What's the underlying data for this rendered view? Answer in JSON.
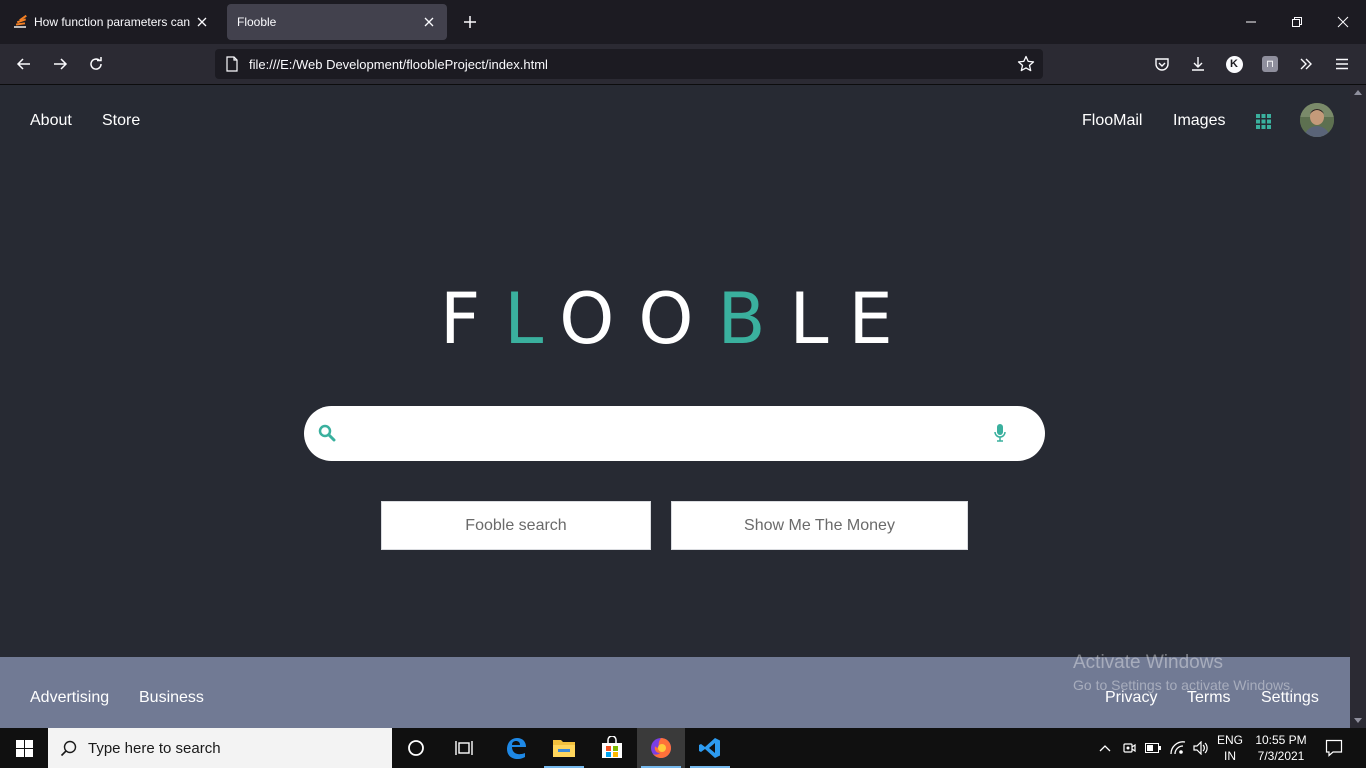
{
  "browser": {
    "tabs": [
      {
        "title": "How function parameters can in",
        "active": false
      },
      {
        "title": "Flooble",
        "active": true
      }
    ],
    "url": "file:///E:/Web Development/floobleProject/index.html",
    "toolbar_avatar_letter": "K"
  },
  "page": {
    "nav_left": [
      "About",
      "Store"
    ],
    "nav_right": [
      "FlooMail",
      "Images"
    ],
    "logo_letters": [
      "F",
      "L",
      "O",
      "O",
      "B",
      "L",
      "E"
    ],
    "logo_accent_color": "#3ab09e",
    "search": {
      "value": "",
      "placeholder": ""
    },
    "buttons": {
      "search_label": "Fooble search",
      "money_label": "Show Me The Money"
    },
    "footer_left": [
      "Advertising",
      "Business"
    ],
    "footer_right": [
      "Privacy",
      "Terms",
      "Settings"
    ],
    "watermark": {
      "line1": "Activate Windows",
      "line2": "Go to Settings to activate Windows."
    }
  },
  "taskbar": {
    "search_placeholder": "Type here to search",
    "language": {
      "line1": "ENG",
      "line2": "IN"
    },
    "clock": {
      "time": "10:55 PM",
      "date": "7/3/2021"
    }
  },
  "colors": {
    "page_bg": "#272a33",
    "footer_bg": "#717a94",
    "accent": "#3ab09e"
  }
}
